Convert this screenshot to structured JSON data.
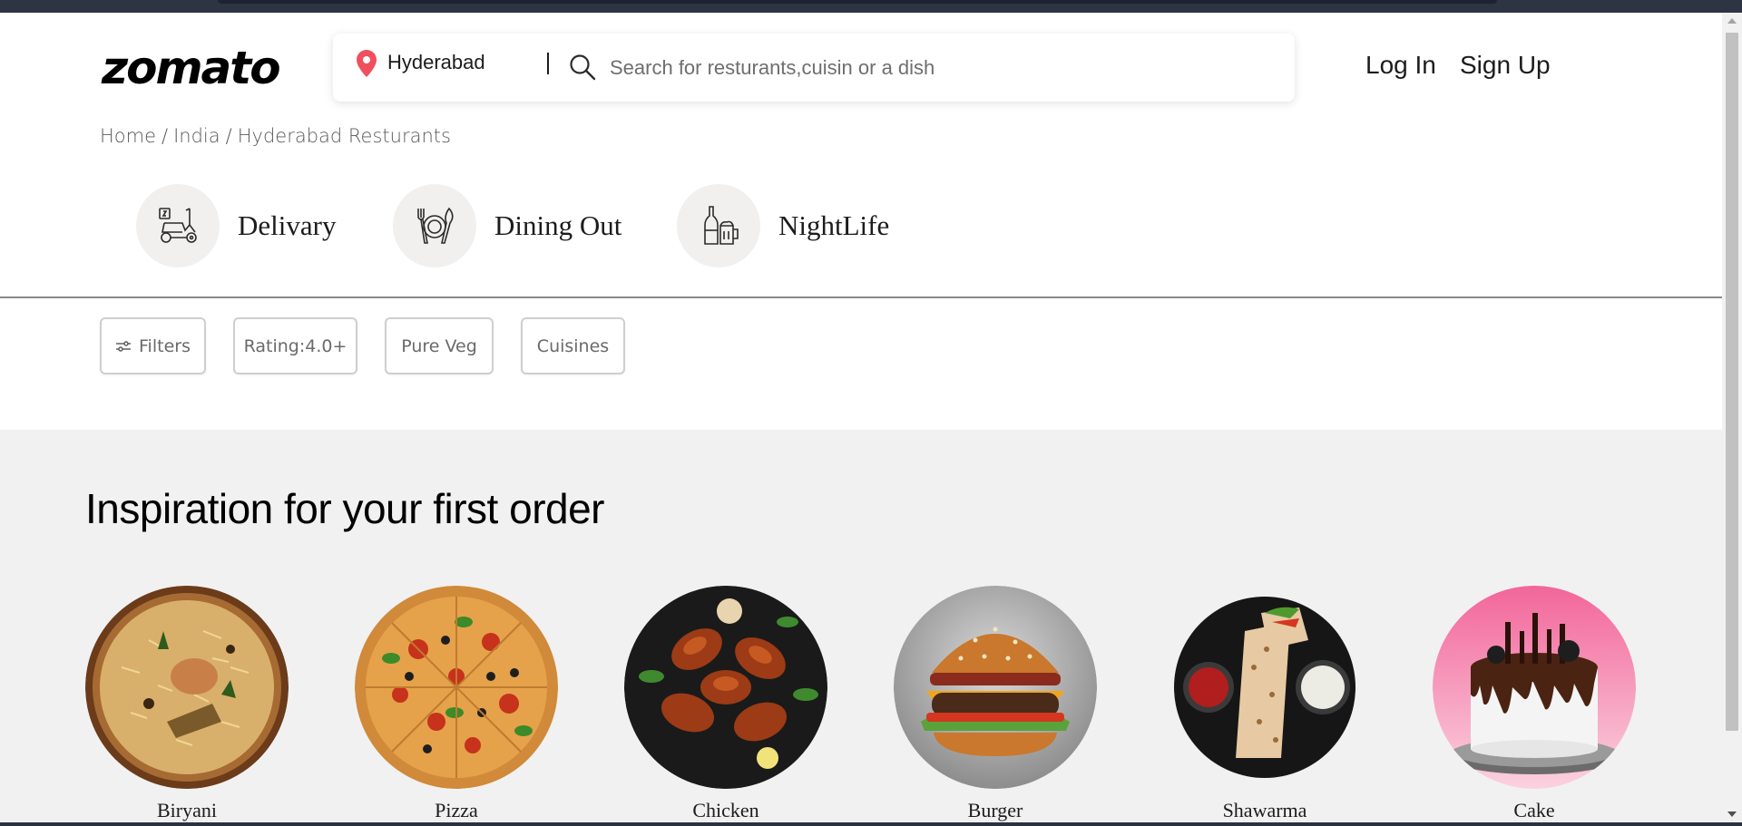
{
  "header": {
    "logo": "zomato",
    "location": "Hyderabad",
    "search_placeholder": "Search for resturants,cuisin or a dish",
    "login_label": "Log In",
    "signup_label": "Sign Up"
  },
  "breadcrumb": [
    "Home",
    "India",
    "Hyderabad Resturants"
  ],
  "tabs": [
    {
      "label": "Delivary",
      "icon": "scooter-icon"
    },
    {
      "label": "Dining Out",
      "icon": "dining-icon"
    },
    {
      "label": "NightLife",
      "icon": "nightlife-icon"
    }
  ],
  "filters": [
    "Filters",
    "Rating:4.0+",
    "Pure Veg",
    "Cuisines"
  ],
  "inspiration": {
    "title": "Inspiration for your first order",
    "items": [
      "Biryani",
      "Pizza",
      "Chicken",
      "Burger",
      "Shawarma",
      "Cake"
    ]
  },
  "colors": {
    "location_pin": "#ef4f5f",
    "page_bg": "#ffffff",
    "section_bg": "#f1f1f1"
  }
}
